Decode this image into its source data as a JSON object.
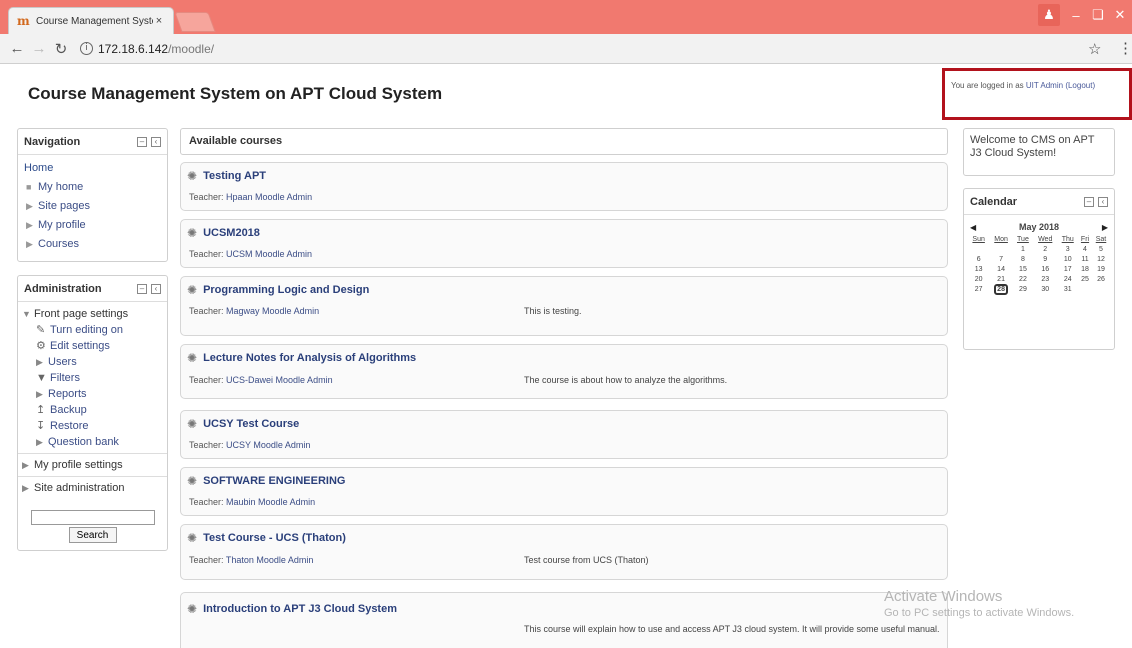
{
  "browser": {
    "tab_title": "Course Management System",
    "tab_close": "×",
    "url_host": "172.18.6.142",
    "url_path": "/moodle/"
  },
  "header": {
    "site_title": "Course Management System on APT Cloud System",
    "login_prefix": "You are logged in as ",
    "login_user": "UIT Admin",
    "logout_label": "(Logout)"
  },
  "navigation": {
    "title": "Navigation",
    "home": "Home",
    "items": [
      "My home",
      "Site pages",
      "My profile",
      "Courses"
    ]
  },
  "administration": {
    "title": "Administration",
    "front_page_settings": "Front page settings",
    "items": {
      "turn_editing_on": "Turn editing on",
      "edit_settings": "Edit settings",
      "users": "Users",
      "filters": "Filters",
      "reports": "Reports",
      "backup": "Backup",
      "restore": "Restore",
      "question_bank": "Question bank"
    },
    "my_profile_settings": "My profile settings",
    "site_administration": "Site administration",
    "search_value": "",
    "search_button": "Search"
  },
  "courses": {
    "header": "Available courses",
    "teacher_label": "Teacher: ",
    "list": [
      {
        "name": "Testing APT",
        "teacher": "Hpaan Moodle Admin",
        "summary": ""
      },
      {
        "name": "UCSM2018",
        "teacher": "UCSM Moodle Admin",
        "summary": ""
      },
      {
        "name": "Programming Logic and Design",
        "teacher": "Magway Moodle Admin",
        "summary": "This is testing."
      },
      {
        "name": "Lecture Notes for Analysis of Algorithms",
        "teacher": "UCS-Dawei Moodle Admin",
        "summary": "The course is about how to analyze the algorithms."
      },
      {
        "name": "UCSY Test Course",
        "teacher": "UCSY Moodle Admin",
        "summary": ""
      },
      {
        "name": "SOFTWARE ENGINEERING",
        "teacher": "Maubin Moodle Admin",
        "summary": ""
      },
      {
        "name": "Test Course - UCS (Thaton)",
        "teacher": "Thaton Moodle Admin",
        "summary": "Test course from UCS (Thaton)"
      },
      {
        "name": "Introduction to APT J3 Cloud System",
        "teacher": "",
        "summary": "This course will explain how to use and access APT J3 cloud system. It will provide some useful manual."
      }
    ]
  },
  "welcome": {
    "text": "Welcome to CMS on APT J3 Cloud System!"
  },
  "calendar": {
    "title": "Calendar",
    "month": "May 2018",
    "weekdays": [
      "Sun",
      "Mon",
      "Tue",
      "Wed",
      "Thu",
      "Fri",
      "Sat"
    ],
    "weeks": [
      [
        "",
        "",
        "1",
        "2",
        "3",
        "4",
        "5"
      ],
      [
        "6",
        "7",
        "8",
        "9",
        "10",
        "11",
        "12"
      ],
      [
        "13",
        "14",
        "15",
        "16",
        "17",
        "18",
        "19"
      ],
      [
        "20",
        "21",
        "22",
        "23",
        "24",
        "25",
        "26"
      ],
      [
        "27",
        "28",
        "29",
        "30",
        "31",
        "",
        ""
      ]
    ],
    "today": "28"
  },
  "watermark": {
    "line1": "Activate Windows",
    "line2": "Go to PC settings to activate Windows."
  }
}
